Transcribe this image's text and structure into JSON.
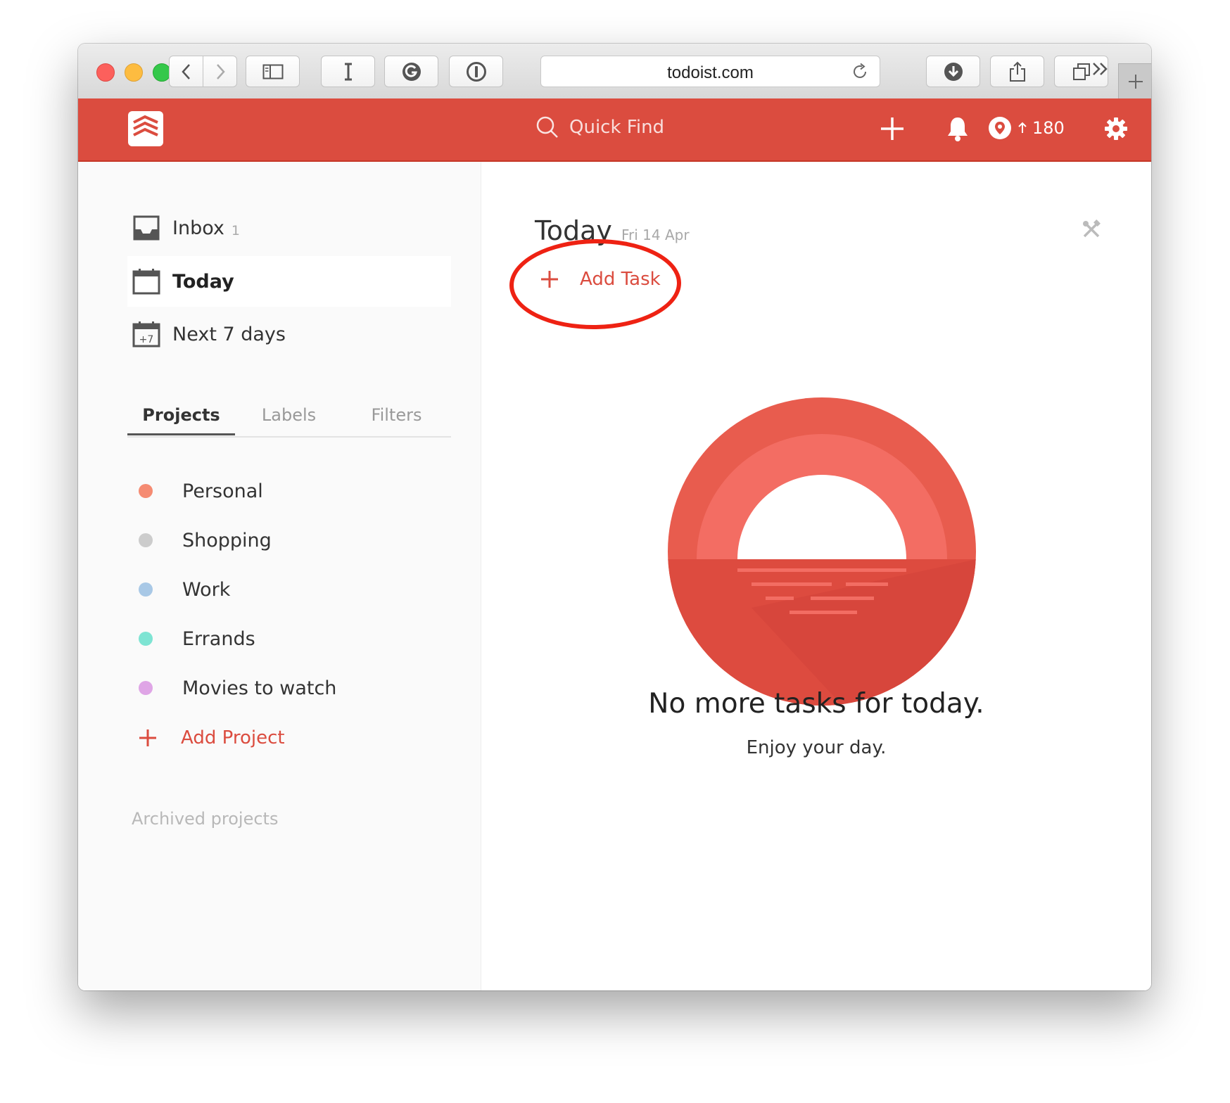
{
  "browser": {
    "url": "todoist.com",
    "icons": [
      "back-icon",
      "forward-icon",
      "sidebar-icon",
      "text-cursor-icon",
      "grammarly-icon",
      "onepassword-icon",
      "reload-icon",
      "download-icon",
      "share-icon",
      "tabs-icon",
      "chevrons-icon",
      "new-tab-icon"
    ]
  },
  "header": {
    "search_placeholder": "Quick Find",
    "karma_value": "180",
    "brand_color": "#db4c3f"
  },
  "sidebar": {
    "nav": [
      {
        "label": "Inbox",
        "count": "1",
        "icon": "inbox-icon"
      },
      {
        "label": "Today",
        "icon": "calendar-icon"
      },
      {
        "label": "Next 7 days",
        "badge": "+7",
        "icon": "calendar-plus7-icon"
      }
    ],
    "tabs": [
      "Projects",
      "Labels",
      "Filters"
    ],
    "projects": [
      {
        "label": "Personal",
        "color": "#f58b72"
      },
      {
        "label": "Shopping",
        "color": "#cccccc"
      },
      {
        "label": "Work",
        "color": "#a8c8e6"
      },
      {
        "label": "Errands",
        "color": "#7ee4d3"
      },
      {
        "label": "Movies to watch",
        "color": "#dfa5e6"
      }
    ],
    "add_project": "Add Project",
    "archived": "Archived projects"
  },
  "main": {
    "title": "Today",
    "date": "Fri 14 Apr",
    "add_task": "Add Task",
    "empty_title": "No more tasks for today.",
    "empty_subtitle": "Enjoy your day."
  }
}
